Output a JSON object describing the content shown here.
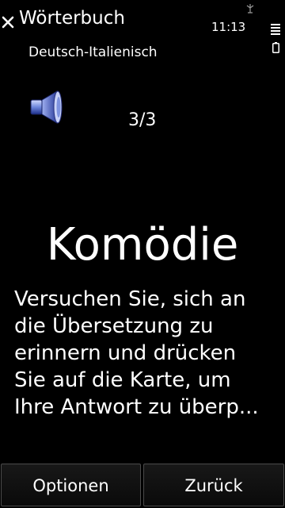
{
  "header": {
    "app_title": "Wörterbuch",
    "clock": "11:13",
    "dictionary": "Deutsch-Italienisch"
  },
  "icons": {
    "close": "close-icon",
    "speaker": "speaker-icon",
    "signal": "signal-icon",
    "battery": "battery-icon"
  },
  "card": {
    "counter": "3/3",
    "word": "Komödie",
    "hint_lines": [
      "Versuchen Sie, sich an",
      "die Übersetzung zu",
      "erinnern und drücken",
      "Sie auf die Karte, um",
      "Ihre Antwort zu überp..."
    ]
  },
  "softkeys": {
    "left": "Optionen",
    "right": "Zurück"
  }
}
